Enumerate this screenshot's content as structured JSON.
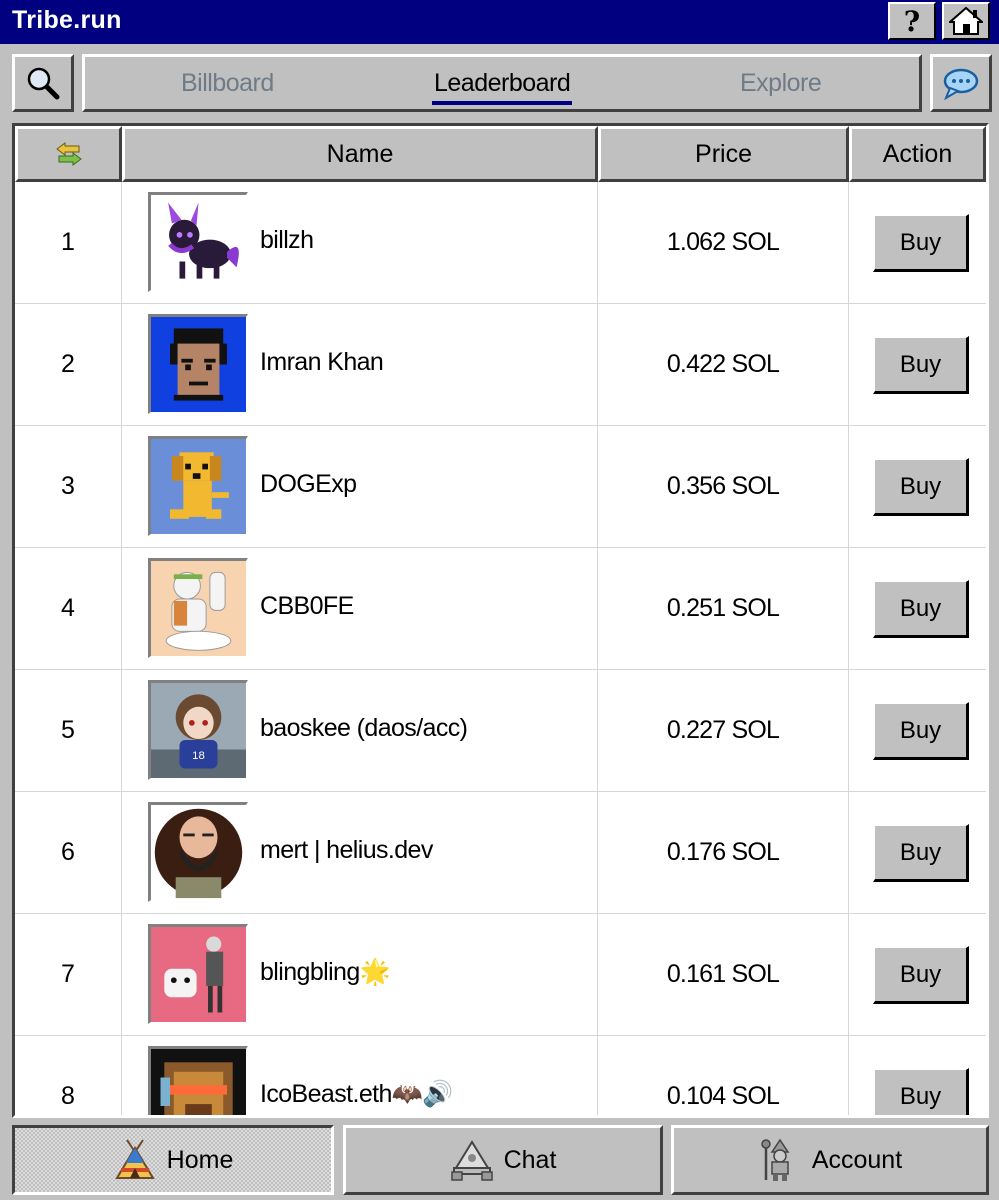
{
  "app": {
    "title": "Tribe.run"
  },
  "titlebar": {
    "help_label": "?"
  },
  "tabs": [
    {
      "label": "Billboard",
      "active": false
    },
    {
      "label": "Leaderboard",
      "active": true
    },
    {
      "label": "Explore",
      "active": false
    }
  ],
  "table": {
    "columns": {
      "name": "Name",
      "price": "Price",
      "action": "Action"
    },
    "rows": [
      {
        "rank": "1",
        "name": "billzh",
        "price": "1.062 SOL",
        "action": "Buy"
      },
      {
        "rank": "2",
        "name": "Imran Khan",
        "price": "0.422 SOL",
        "action": "Buy"
      },
      {
        "rank": "3",
        "name": "DOGExp",
        "price": "0.356 SOL",
        "action": "Buy"
      },
      {
        "rank": "4",
        "name": "CBB0FE",
        "price": "0.251 SOL",
        "action": "Buy"
      },
      {
        "rank": "5",
        "name": "baoskee (daos/acc)",
        "price": "0.227 SOL",
        "action": "Buy"
      },
      {
        "rank": "6",
        "name": "mert | helius.dev",
        "price": "0.176 SOL",
        "action": "Buy"
      },
      {
        "rank": "7",
        "name": "blingbling🌟",
        "price": "0.161 SOL",
        "action": "Buy"
      },
      {
        "rank": "8",
        "name": "IcoBeast.eth🦇🔊",
        "price": "0.104 SOL",
        "action": "Buy"
      }
    ]
  },
  "bottom_nav": [
    {
      "label": "Home",
      "icon": "tipi-icon",
      "active": true
    },
    {
      "label": "Chat",
      "icon": "campfire-icon",
      "active": false
    },
    {
      "label": "Account",
      "icon": "shaman-icon",
      "active": false
    }
  ],
  "colors": {
    "titlebar": "#000080",
    "chrome": "#c0c0c0",
    "inactive_tab": "#6f7b86"
  }
}
